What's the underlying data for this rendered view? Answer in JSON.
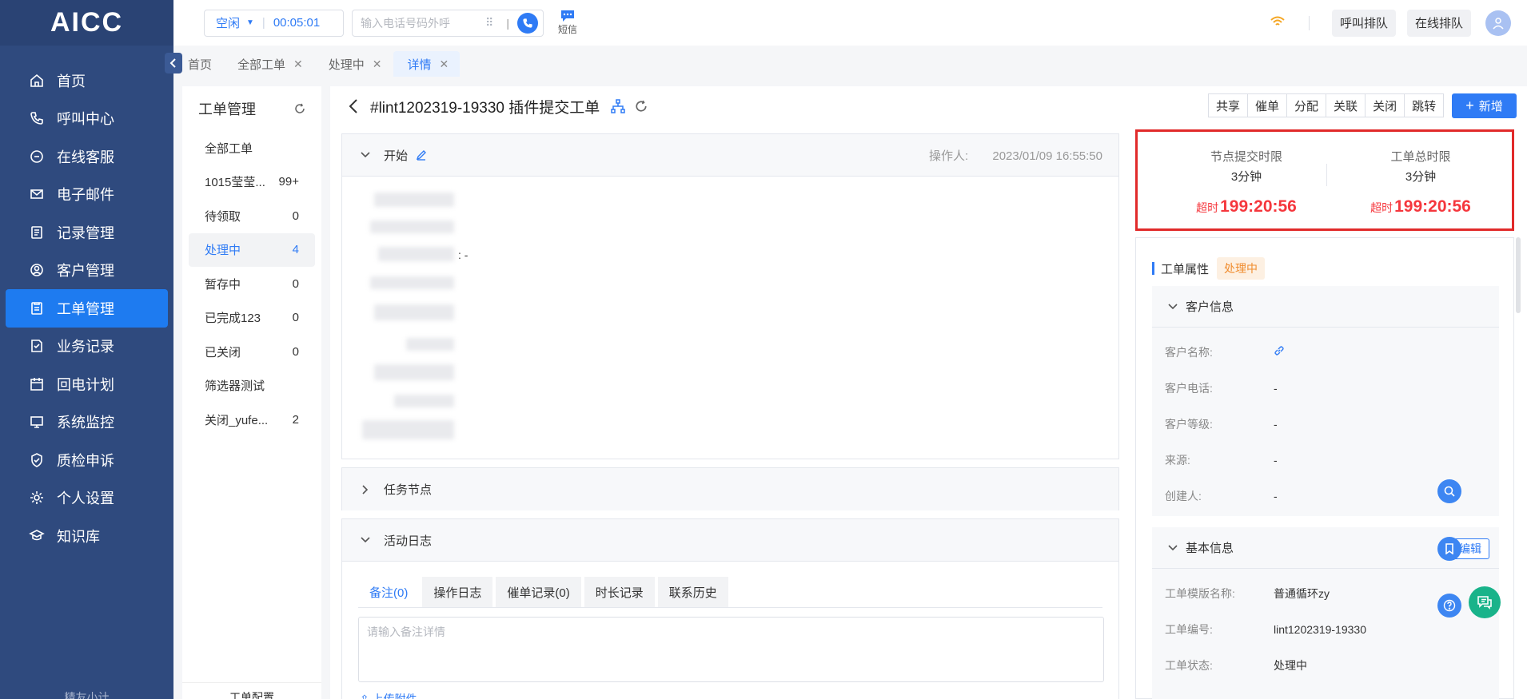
{
  "app": {
    "logo": "AICC"
  },
  "sidebar": {
    "items": [
      {
        "label": "首页",
        "icon": "home-icon"
      },
      {
        "label": "呼叫中心",
        "icon": "phone-icon"
      },
      {
        "label": "在线客服",
        "icon": "chat-icon"
      },
      {
        "label": "电子邮件",
        "icon": "mail-icon"
      },
      {
        "label": "记录管理",
        "icon": "record-icon"
      },
      {
        "label": "客户管理",
        "icon": "user-icon"
      },
      {
        "label": "工单管理",
        "icon": "ticket-icon",
        "active": true
      },
      {
        "label": "业务记录",
        "icon": "note-icon"
      },
      {
        "label": "回电计划",
        "icon": "calendar-icon"
      },
      {
        "label": "系统监控",
        "icon": "monitor-icon"
      },
      {
        "label": "质检申诉",
        "icon": "shield-icon"
      },
      {
        "label": "个人设置",
        "icon": "gear-icon"
      },
      {
        "label": "知识库",
        "icon": "book-icon"
      }
    ],
    "bottom": "精友小计"
  },
  "topbar": {
    "status": "空闲",
    "timer": "00:05:01",
    "dial_placeholder": "输入电话号码外呼",
    "sms": "短信",
    "call_queue": "呼叫排队",
    "online_queue": "在线排队"
  },
  "tabs": [
    {
      "label": "首页",
      "closable": false
    },
    {
      "label": "全部工单",
      "closable": true
    },
    {
      "label": "处理中",
      "closable": true
    },
    {
      "label": "详情",
      "closable": true,
      "active": true
    }
  ],
  "list": {
    "title": "工单管理",
    "items": [
      {
        "label": "全部工单",
        "count": ""
      },
      {
        "label": "1015莹莹...",
        "count": "99+"
      },
      {
        "label": "待领取",
        "count": "0"
      },
      {
        "label": "处理中",
        "count": "4",
        "active": true
      },
      {
        "label": "暂存中",
        "count": "0"
      },
      {
        "label": "已完成123",
        "count": "0"
      },
      {
        "label": "已关闭",
        "count": "0"
      },
      {
        "label": "筛选器测试",
        "count": ""
      },
      {
        "label": "关闭_yufe...",
        "count": "2"
      }
    ],
    "bottom": "工单配置"
  },
  "detail": {
    "title": "#lint1202319-19330 插件提交工单",
    "actions": [
      "共享",
      "催单",
      "分配",
      "关联",
      "关闭",
      "跳转"
    ],
    "add": "新增",
    "start": {
      "label": "开始",
      "operator_label": "操作人:",
      "time": "2023/01/09 16:55:50",
      "colon_dash": ": -"
    },
    "task_nodes": "任务节点",
    "activity_log": {
      "label": "活动日志",
      "tabs": [
        "备注(0)",
        "操作日志",
        "催单记录(0)",
        "时长记录",
        "联系历史"
      ],
      "note_placeholder": "请输入备注详情",
      "upload": "上传附件"
    }
  },
  "timer": {
    "node": {
      "label": "节点提交时限",
      "value": "3分钟",
      "over_label": "超时",
      "over_value": "199:20:56"
    },
    "total": {
      "label": "工单总时限",
      "value": "3分钟",
      "over_label": "超时",
      "over_value": "199:20:56"
    }
  },
  "attributes": {
    "title": "工单属性",
    "status_badge": "处理中",
    "customer": {
      "title": "客户信息",
      "fields": [
        {
          "k": "客户名称:",
          "v": ""
        },
        {
          "k": "客户电话:",
          "v": "-"
        },
        {
          "k": "客户等级:",
          "v": "-"
        },
        {
          "k": "来源:",
          "v": "-"
        },
        {
          "k": "创建人:",
          "v": "-"
        }
      ]
    },
    "basic": {
      "title": "基本信息",
      "edit": "编辑",
      "fields": [
        {
          "k": "工单模版名称:",
          "v": "普通循环zy"
        },
        {
          "k": "工单编号:",
          "v": "lint1202319-19330"
        },
        {
          "k": "工单状态:",
          "v": "处理中"
        }
      ]
    }
  },
  "colors": {
    "primary": "#2f7bf5",
    "sidebar": "#2f4a7e",
    "danger": "#f5373d",
    "warning": "#f08c2e"
  }
}
